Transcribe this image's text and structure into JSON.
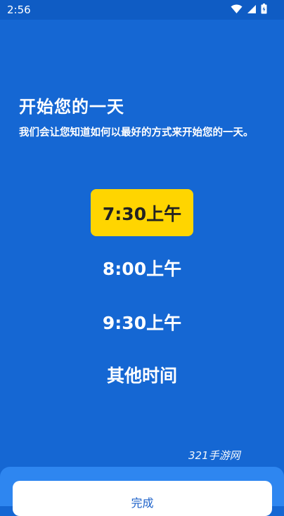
{
  "status_bar": {
    "time": "2:56",
    "icons": [
      "wifi-icon",
      "cellular-signal-icon",
      "battery-icon"
    ]
  },
  "header": {
    "title": "开始您的一天",
    "subtitle": "我们会让您知道如何以最好的方式来开始您的一天。"
  },
  "time_options": [
    {
      "label": "7:30上午",
      "selected": true
    },
    {
      "label": "8:00上午",
      "selected": false
    },
    {
      "label": "9:30上午",
      "selected": false
    },
    {
      "label": "其他时间",
      "selected": false
    }
  ],
  "watermark": "321手游网",
  "footer": {
    "done_label": "完成"
  },
  "colors": {
    "background": "#1567d3",
    "status_bar": "#0f5cc4",
    "selected_option": "#ffd500",
    "sheet": "#2e86f0",
    "button_text": "#1a5fc8"
  }
}
